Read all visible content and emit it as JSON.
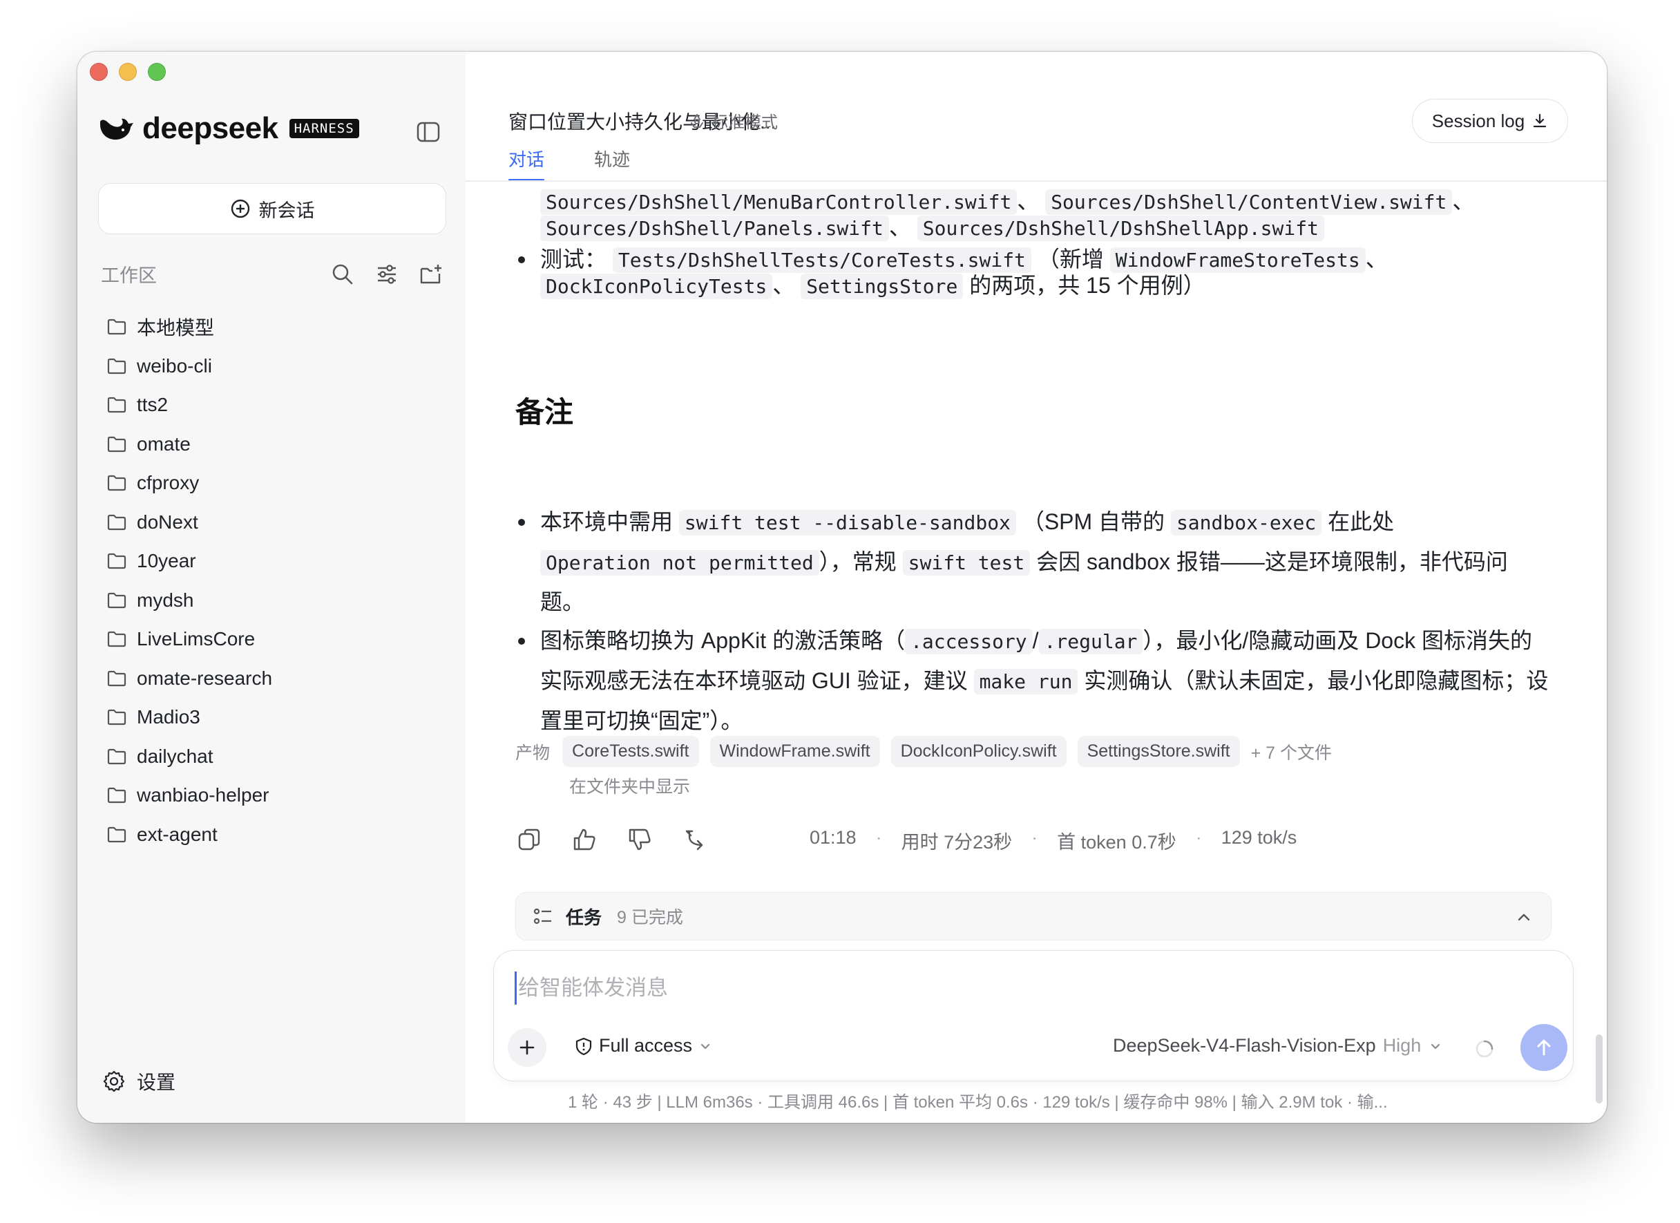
{
  "brand": {
    "name": "deepseek",
    "badge": "HARNESS"
  },
  "sidebar": {
    "new_chat_label": "新会话",
    "workspace_label": "工作区",
    "folders": [
      "本地模型",
      "weibo-cli",
      "tts2",
      "omate",
      "cfproxy",
      "doNext",
      "10year",
      "mydsh",
      "LiveLimsCore",
      "omate-research",
      "Madio3",
      "dailychat",
      "wanbiao-helper",
      "ext-agent"
    ],
    "settings_label": "设置"
  },
  "header": {
    "title": "窗口位置大小持久化与最小化...",
    "mode_label": "标准模式",
    "session_log_label": "Session log",
    "tabs": [
      {
        "label": "对话"
      },
      {
        "label": "轨迹"
      }
    ]
  },
  "message": {
    "files_line1": {
      "c1": "Sources/DshShell/MenuBarController.swift",
      "s1": "、",
      "c2": "Sources/DshShell/ContentView.swift",
      "s2": "、"
    },
    "files_line2": {
      "c1": "Sources/DshShell/Panels.swift",
      "s1": "、",
      "c2": "Sources/DshShell/DshShellApp.swift"
    },
    "tests_line1": {
      "prefix": "测试：",
      "c1": "Tests/DshShellTests/CoreTests.swift",
      "t1": "（新增",
      "c2": "WindowFrameStoreTests",
      "s1": "、"
    },
    "tests_line2": {
      "c1": "DockIconPolicyTests",
      "s1": "、",
      "c2": "SettingsStore",
      "t1": "的两项，共 15 个用例）"
    },
    "notes_heading": "备注",
    "note1_line1": {
      "t1": "本环境中需用",
      "c1": "swift test --disable-sandbox",
      "t2": "（SPM 自带的",
      "c2": "sandbox-exec",
      "t3": "在此处"
    },
    "note1_line2": {
      "c1": "Operation not permitted",
      "t1": "），常规",
      "c2": "swift test",
      "t2": "会因 sandbox 报错——这是环境限制，非代码问"
    },
    "note1_line3": "题。",
    "note2_line1": {
      "t1": "图标策略切换为 AppKit 的激活策略（",
      "c1": ".accessory",
      "t2": "/",
      "c2": ".regular",
      "t3": "），最小化/隐藏动画及 Dock 图标消失的"
    },
    "note2_line2": {
      "t1": "实际观感无法在本环境驱动 GUI 验证，建议",
      "c1": "make run",
      "t2": "实测确认（默认未固定，最小化即隐藏图标；设"
    },
    "note2_line3": "置里可切换“固定”）。"
  },
  "artifacts": {
    "label": "产物",
    "files": [
      "CoreTests.swift",
      "WindowFrame.swift",
      "DockIconPolicy.swift",
      "SettingsStore.swift"
    ],
    "more": "+ 7 个文件",
    "show_in_folder": "在文件夹中显示"
  },
  "stats": {
    "time": "01:18",
    "duration": "用时 7分23秒",
    "first_token": "首 token 0.7秒",
    "speed": "129 tok/s",
    "sep": "·"
  },
  "tasks": {
    "title": "任务",
    "count": "9 已完成"
  },
  "composer": {
    "placeholder": "给智能体发消息",
    "access_label": "Full access",
    "model": "DeepSeek-V4-Flash-Vision-Exp",
    "level": "High"
  },
  "footer": "1 轮 · 43 步   |   LLM 6m36s · 工具调用 46.6s   |   首 token 平均 0.6s · 129 tok/s   |   缓存命中 98%   |   输入 2.9M tok · 输...",
  "colors": {
    "accent": "#3b6cf6",
    "send": "#a9b9f7",
    "sidebar_bg": "#f7f7f8"
  }
}
